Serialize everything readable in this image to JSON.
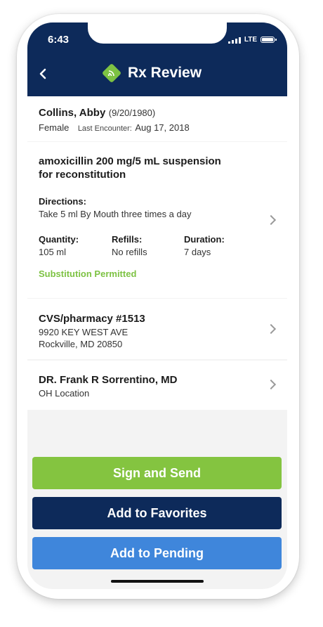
{
  "status_bar": {
    "time": "6:43",
    "network": "LTE"
  },
  "header": {
    "back_icon": "chevron-left-icon",
    "logo_icon": "rx-logo-icon",
    "title": "Rx Review"
  },
  "patient": {
    "name": "Collins, Abby",
    "dob": "(9/20/1980)",
    "sex": "Female",
    "encounter_label": "Last Encounter:",
    "encounter_date": "Aug 17, 2018"
  },
  "prescription": {
    "drug_line1": "amoxicillin 200 mg/5 mL suspension",
    "drug_line2": "for reconstitution",
    "directions_label": "Directions:",
    "directions": "Take 5 ml By Mouth three times a day",
    "quantity_label": "Quantity:",
    "quantity": "105 ml",
    "refills_label": "Refills:",
    "refills": "No refills",
    "duration_label": "Duration:",
    "duration": "7 days",
    "substitution": "Substitution Permitted"
  },
  "pharmacy": {
    "name": "CVS/pharmacy #1513",
    "address1": "9920 KEY WEST AVE",
    "address2": "Rockville, MD 20850"
  },
  "doctor": {
    "name": "DR. Frank R Sorrentino, MD",
    "location": "OH Location"
  },
  "buttons": {
    "sign": "Sign and Send",
    "favorites": "Add to Favorites",
    "pending": "Add to Pending"
  },
  "colors": {
    "navy": "#0d2a5a",
    "green": "#84c440",
    "blue": "#3f86db"
  }
}
